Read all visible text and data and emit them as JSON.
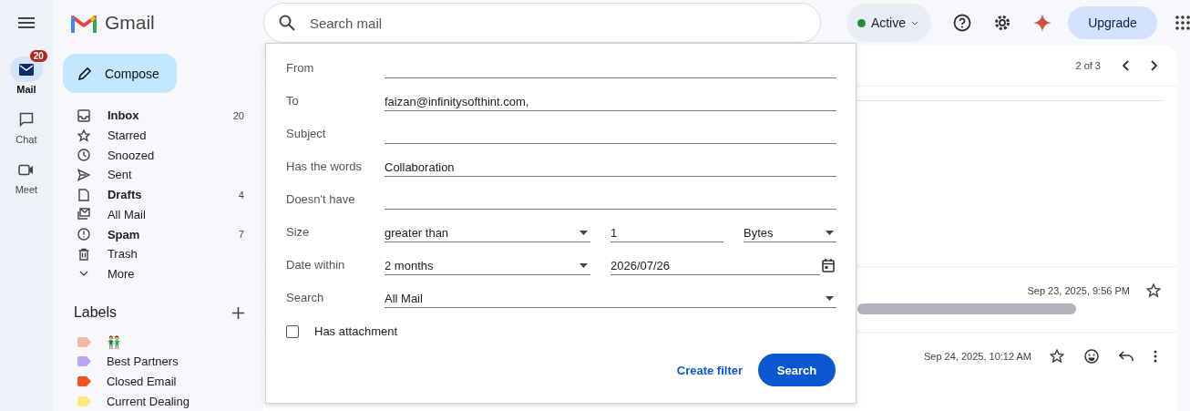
{
  "app": {
    "name": "Gmail"
  },
  "rail": [
    {
      "label": "Mail",
      "selected": true,
      "badge": "20",
      "kind": "mail"
    },
    {
      "label": "Chat",
      "selected": false,
      "kind": "chat"
    },
    {
      "label": "Meet",
      "selected": false,
      "kind": "meet"
    }
  ],
  "search": {
    "placeholder": "Search mail"
  },
  "status": {
    "label": "Active",
    "color": "#1e8e3e"
  },
  "upgrade": "Upgrade",
  "compose": "Compose",
  "folders": [
    {
      "label": "Inbox",
      "kind": "inbox",
      "bold": true,
      "count": "20"
    },
    {
      "label": "Starred",
      "kind": "star",
      "bold": false
    },
    {
      "label": "Snoozed",
      "kind": "clock",
      "bold": false
    },
    {
      "label": "Sent",
      "kind": "sent",
      "bold": false
    },
    {
      "label": "Drafts",
      "kind": "draft",
      "bold": true,
      "count": "4"
    },
    {
      "label": "All Mail",
      "kind": "allmail",
      "bold": false
    },
    {
      "label": "Spam",
      "kind": "spam",
      "bold": true,
      "count": "7"
    },
    {
      "label": "Trash",
      "kind": "trash",
      "bold": false
    },
    {
      "label": "More",
      "kind": "more",
      "bold": false
    }
  ],
  "labels": {
    "title": "Labels",
    "items": [
      {
        "label": "👬",
        "color": "#f2b8a8"
      },
      {
        "label": "Best Partners",
        "color": "#b9a5f5"
      },
      {
        "label": "Closed Email",
        "color": "#f4511e"
      },
      {
        "label": "Current Dealing",
        "color": "#fce97a"
      }
    ]
  },
  "pager": "2 of 3",
  "messages": [
    {
      "kind": "collapsed",
      "date": "Sep 23, 2025, 9:56 PM",
      "starred": false
    },
    {
      "kind": "expanded",
      "date": "Sep 24, 2025, 10:12 AM",
      "starred": false
    }
  ],
  "search_form": {
    "rows": [
      {
        "kind": "text",
        "label": "From"
      },
      {
        "kind": "text",
        "label": "To",
        "value": "faizan@infinitysofthint.com,"
      },
      {
        "kind": "text",
        "label": "Subject"
      },
      {
        "kind": "text",
        "label": "Has the words",
        "value": "Collaboration"
      },
      {
        "kind": "text",
        "label": "Doesn't have"
      },
      {
        "kind": "size",
        "label": "Size",
        "operator": "greater than",
        "amount": "1",
        "unit": "Bytes"
      },
      {
        "kind": "date",
        "label": "Date within",
        "range": "2 months",
        "date": "2026/07/26"
      },
      {
        "kind": "select",
        "label": "Search",
        "value": "All Mail"
      }
    ],
    "checkbox": {
      "label": "Has attachment",
      "checked": false
    },
    "create_filter": "Create filter",
    "submit": "Search"
  }
}
